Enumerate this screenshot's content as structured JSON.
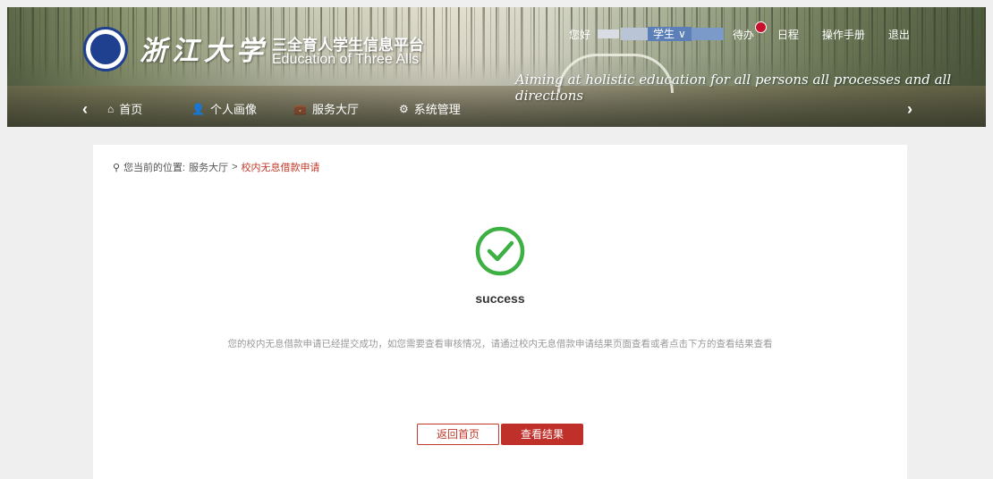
{
  "header": {
    "logo_text": "浙江大学",
    "platform_title_cn": "三全育人学生信息平台",
    "platform_title_en": "Education of Three Alls",
    "slogan": "Aiming at holistic education for all persons all processes and all directions"
  },
  "userbar": {
    "greeting": "您好",
    "role": "学生",
    "role_caret": "∨",
    "todo": "待办",
    "schedule": "日程",
    "manual": "操作手册",
    "logout": "退出"
  },
  "nav": {
    "prev_arrow": "‹",
    "next_arrow": "›",
    "items": [
      {
        "label": "首页",
        "icon": "home-icon",
        "glyph": "⌂"
      },
      {
        "label": "个人画像",
        "icon": "user-icon",
        "glyph": "👤"
      },
      {
        "label": "服务大厅",
        "icon": "briefcase-icon",
        "glyph": "💼"
      },
      {
        "label": "系统管理",
        "icon": "gears-icon",
        "glyph": "⚙"
      }
    ]
  },
  "breadcrumb": {
    "prefix": "您当前的位置:",
    "parent": "服务大厅",
    "separator": ">",
    "current": "校内无息借款申请"
  },
  "result": {
    "title": "success",
    "message": "您的校内无息借款申请已经提交成功，如您需要查看审核情况，请通过校内无息借款申请结果页面查看或者点击下方的查看结果查看"
  },
  "buttons": {
    "home": "返回首页",
    "view_result": "查看结果"
  },
  "colors": {
    "accent_red": "#c0302a",
    "success_green": "#3cb043",
    "role_blue": "#5c7fb8"
  }
}
